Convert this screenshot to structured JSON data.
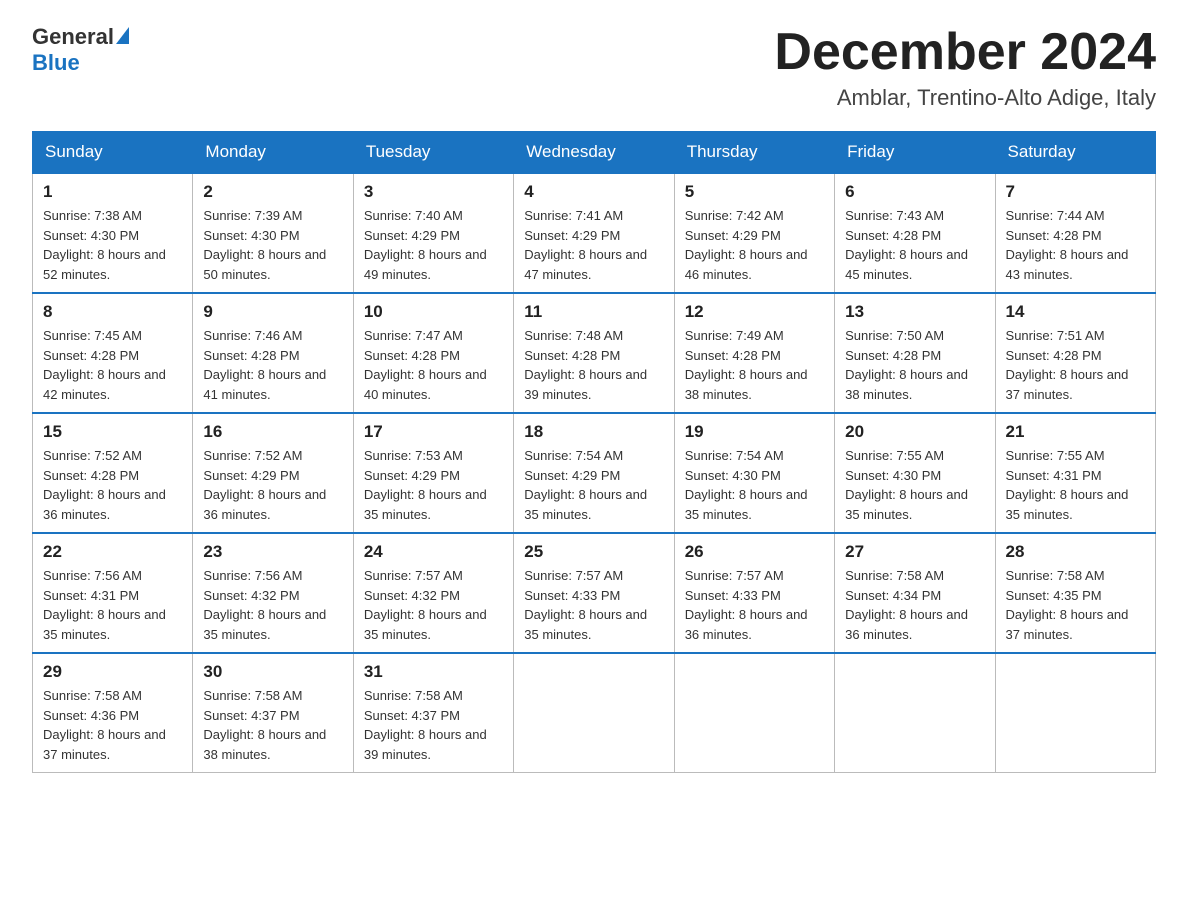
{
  "logo": {
    "general": "General",
    "blue": "Blue"
  },
  "title": {
    "month": "December 2024",
    "location": "Amblar, Trentino-Alto Adige, Italy"
  },
  "headers": [
    "Sunday",
    "Monday",
    "Tuesday",
    "Wednesday",
    "Thursday",
    "Friday",
    "Saturday"
  ],
  "weeks": [
    [
      {
        "day": "1",
        "sunrise": "7:38 AM",
        "sunset": "4:30 PM",
        "daylight": "8 hours and 52 minutes."
      },
      {
        "day": "2",
        "sunrise": "7:39 AM",
        "sunset": "4:30 PM",
        "daylight": "8 hours and 50 minutes."
      },
      {
        "day": "3",
        "sunrise": "7:40 AM",
        "sunset": "4:29 PM",
        "daylight": "8 hours and 49 minutes."
      },
      {
        "day": "4",
        "sunrise": "7:41 AM",
        "sunset": "4:29 PM",
        "daylight": "8 hours and 47 minutes."
      },
      {
        "day": "5",
        "sunrise": "7:42 AM",
        "sunset": "4:29 PM",
        "daylight": "8 hours and 46 minutes."
      },
      {
        "day": "6",
        "sunrise": "7:43 AM",
        "sunset": "4:28 PM",
        "daylight": "8 hours and 45 minutes."
      },
      {
        "day": "7",
        "sunrise": "7:44 AM",
        "sunset": "4:28 PM",
        "daylight": "8 hours and 43 minutes."
      }
    ],
    [
      {
        "day": "8",
        "sunrise": "7:45 AM",
        "sunset": "4:28 PM",
        "daylight": "8 hours and 42 minutes."
      },
      {
        "day": "9",
        "sunrise": "7:46 AM",
        "sunset": "4:28 PM",
        "daylight": "8 hours and 41 minutes."
      },
      {
        "day": "10",
        "sunrise": "7:47 AM",
        "sunset": "4:28 PM",
        "daylight": "8 hours and 40 minutes."
      },
      {
        "day": "11",
        "sunrise": "7:48 AM",
        "sunset": "4:28 PM",
        "daylight": "8 hours and 39 minutes."
      },
      {
        "day": "12",
        "sunrise": "7:49 AM",
        "sunset": "4:28 PM",
        "daylight": "8 hours and 38 minutes."
      },
      {
        "day": "13",
        "sunrise": "7:50 AM",
        "sunset": "4:28 PM",
        "daylight": "8 hours and 38 minutes."
      },
      {
        "day": "14",
        "sunrise": "7:51 AM",
        "sunset": "4:28 PM",
        "daylight": "8 hours and 37 minutes."
      }
    ],
    [
      {
        "day": "15",
        "sunrise": "7:52 AM",
        "sunset": "4:28 PM",
        "daylight": "8 hours and 36 minutes."
      },
      {
        "day": "16",
        "sunrise": "7:52 AM",
        "sunset": "4:29 PM",
        "daylight": "8 hours and 36 minutes."
      },
      {
        "day": "17",
        "sunrise": "7:53 AM",
        "sunset": "4:29 PM",
        "daylight": "8 hours and 35 minutes."
      },
      {
        "day": "18",
        "sunrise": "7:54 AM",
        "sunset": "4:29 PM",
        "daylight": "8 hours and 35 minutes."
      },
      {
        "day": "19",
        "sunrise": "7:54 AM",
        "sunset": "4:30 PM",
        "daylight": "8 hours and 35 minutes."
      },
      {
        "day": "20",
        "sunrise": "7:55 AM",
        "sunset": "4:30 PM",
        "daylight": "8 hours and 35 minutes."
      },
      {
        "day": "21",
        "sunrise": "7:55 AM",
        "sunset": "4:31 PM",
        "daylight": "8 hours and 35 minutes."
      }
    ],
    [
      {
        "day": "22",
        "sunrise": "7:56 AM",
        "sunset": "4:31 PM",
        "daylight": "8 hours and 35 minutes."
      },
      {
        "day": "23",
        "sunrise": "7:56 AM",
        "sunset": "4:32 PM",
        "daylight": "8 hours and 35 minutes."
      },
      {
        "day": "24",
        "sunrise": "7:57 AM",
        "sunset": "4:32 PM",
        "daylight": "8 hours and 35 minutes."
      },
      {
        "day": "25",
        "sunrise": "7:57 AM",
        "sunset": "4:33 PM",
        "daylight": "8 hours and 35 minutes."
      },
      {
        "day": "26",
        "sunrise": "7:57 AM",
        "sunset": "4:33 PM",
        "daylight": "8 hours and 36 minutes."
      },
      {
        "day": "27",
        "sunrise": "7:58 AM",
        "sunset": "4:34 PM",
        "daylight": "8 hours and 36 minutes."
      },
      {
        "day": "28",
        "sunrise": "7:58 AM",
        "sunset": "4:35 PM",
        "daylight": "8 hours and 37 minutes."
      }
    ],
    [
      {
        "day": "29",
        "sunrise": "7:58 AM",
        "sunset": "4:36 PM",
        "daylight": "8 hours and 37 minutes."
      },
      {
        "day": "30",
        "sunrise": "7:58 AM",
        "sunset": "4:37 PM",
        "daylight": "8 hours and 38 minutes."
      },
      {
        "day": "31",
        "sunrise": "7:58 AM",
        "sunset": "4:37 PM",
        "daylight": "8 hours and 39 minutes."
      },
      null,
      null,
      null,
      null
    ]
  ]
}
